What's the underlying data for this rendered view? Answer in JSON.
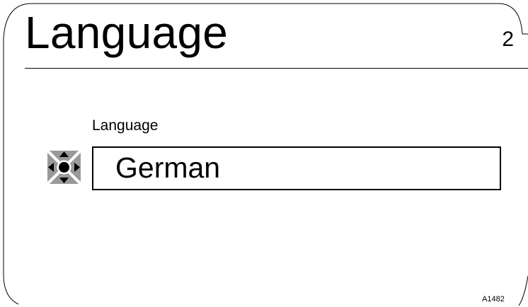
{
  "screen": {
    "title": "Language",
    "page_number": "2"
  },
  "field": {
    "label": "Language",
    "value": "German",
    "icon": "navigation-keypad-icon"
  },
  "footer": {
    "reference_code": "A1482"
  }
}
